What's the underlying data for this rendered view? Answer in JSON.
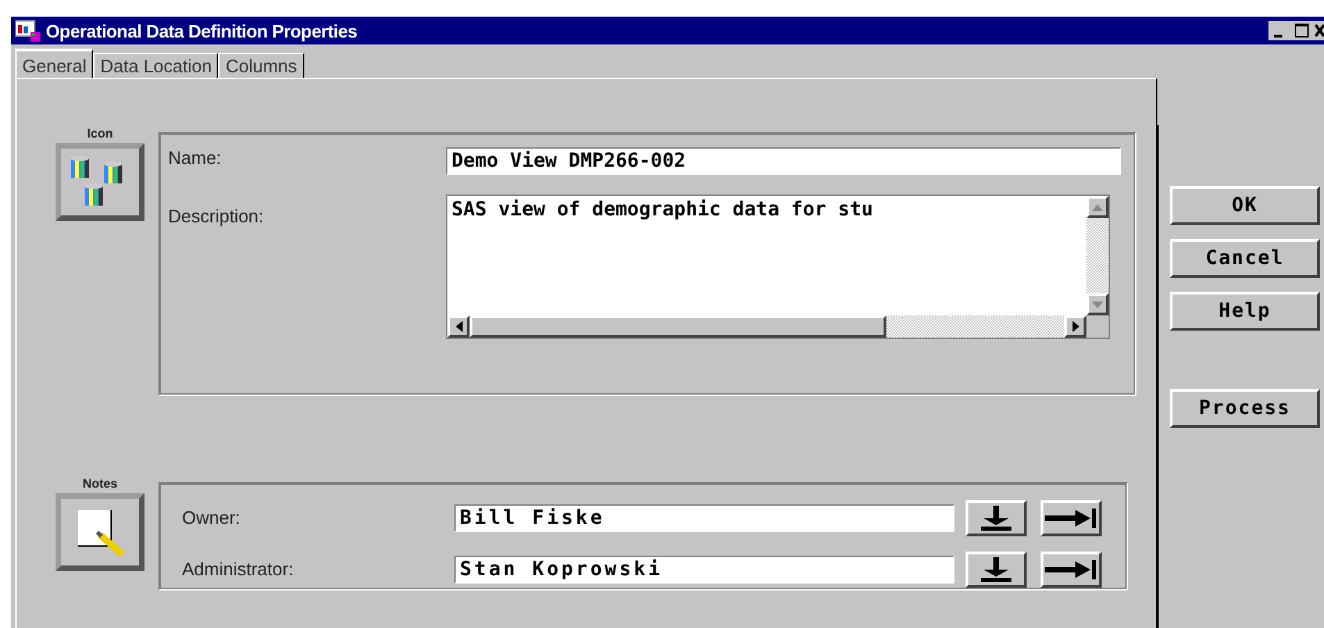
{
  "window": {
    "title": "Operational Data Definition Properties"
  },
  "tabs": [
    {
      "label": "General",
      "selected": true
    },
    {
      "label": "Data Location",
      "selected": false
    },
    {
      "label": "Columns",
      "selected": false
    }
  ],
  "icon_group": {
    "label": "Icon"
  },
  "name": {
    "label": "Name:",
    "value": "Demo View DMP266-002"
  },
  "description": {
    "label": "Description:",
    "value": "SAS view of demographic data for stu"
  },
  "notes_group": {
    "label": "Notes"
  },
  "people": [
    {
      "label": "Owner:",
      "value": "Bill Fiske"
    },
    {
      "label": "Administrator:",
      "value": "Stan Koprowski"
    }
  ],
  "buttons": [
    {
      "label": "OK",
      "kind": "main"
    },
    {
      "label": "Cancel",
      "kind": "main"
    },
    {
      "label": "Help",
      "kind": "main"
    },
    {
      "label": "Process",
      "kind": "extra"
    }
  ]
}
